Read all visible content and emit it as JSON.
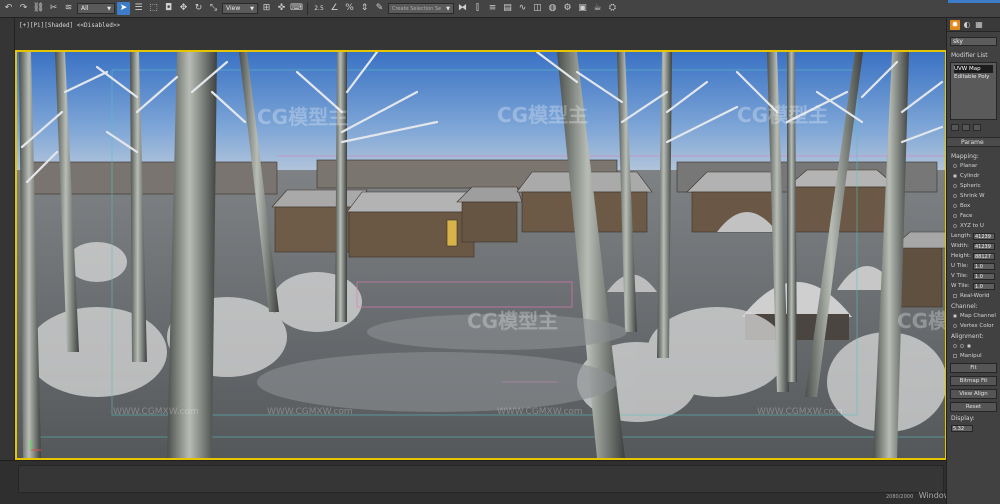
{
  "toolbar": {
    "selection_filter": "All",
    "reference_coord": "View",
    "snap_value": "2.5",
    "named_selection_placeholder": "Create Selection Se"
  },
  "viewport": {
    "label": "[+][Pi][Shaded] <<Disabled>>",
    "watermark": "CG模型主",
    "watermark_url": "WWW.CGMXW.com"
  },
  "command_panel": {
    "object_name": "sky",
    "modifier_list_label": "Modifier List",
    "modifier_stack": [
      "UVW Map",
      "Editable Poly"
    ],
    "parameters_title": "Parame",
    "mapping_label": "Mapping:",
    "mapping_options": [
      "Planar",
      "Cylindr",
      "Spheric",
      "Shrink W",
      "Box",
      "Face",
      "XYZ to U"
    ],
    "mapping_selected": 1,
    "params": [
      {
        "label": "Length:",
        "value": "41239"
      },
      {
        "label": "Width:",
        "value": "41239"
      },
      {
        "label": "Height:",
        "value": "88127"
      },
      {
        "label": "U Tile:",
        "value": "1.0"
      },
      {
        "label": "V Tile:",
        "value": "1.0"
      },
      {
        "label": "W Tile:",
        "value": "1.0"
      }
    ],
    "real_world_label": "Real-World",
    "channel_label": "Channel:",
    "channel_options": [
      "Map Channel",
      "Vertex Color"
    ],
    "alignment_label": "Alignment:",
    "manipulate_label": "Manipul",
    "fit_label": "Fit",
    "bitmap_fit_label": "Bitmap Fit",
    "view_align_label": "View Align",
    "reset_label": "Reset",
    "display_label": "Display:",
    "display_value": "5.32"
  },
  "status": {
    "windows_text": "Windows",
    "counter": "2080/2000"
  },
  "colors": {
    "accent": "#3d7cc9",
    "viewport_border": "#e5c400",
    "command_tab_active": "#e08a1e"
  }
}
